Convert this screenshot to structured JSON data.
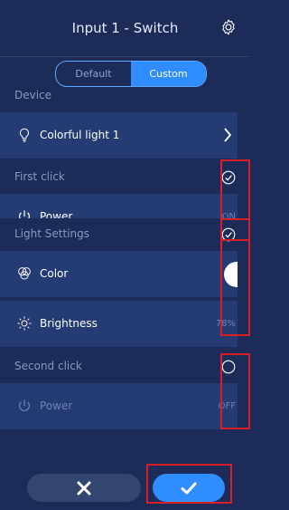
{
  "header": {
    "title": "Input 1 - Switch",
    "settings_icon": "gear-icon"
  },
  "mode_toggle": {
    "options": [
      "Default",
      "Custom"
    ],
    "selected": "Custom"
  },
  "device": {
    "section_label": "Device",
    "name": "Colorful light 1",
    "icon": "bulb-icon"
  },
  "first_click": {
    "section_label": "First click",
    "checked": true,
    "power": {
      "label": "Power",
      "value": "ON"
    }
  },
  "light_settings": {
    "section_label": "Light Settings",
    "checked": true,
    "color": {
      "label": "Color",
      "swatch": "#ffffff"
    },
    "brightness": {
      "label": "Brightness",
      "value": "78%"
    }
  },
  "second_click": {
    "section_label": "Second click",
    "checked": false,
    "power": {
      "label": "Power",
      "value": "OFF"
    }
  },
  "footer": {
    "cancel_icon": "close-icon",
    "confirm_icon": "check-icon"
  },
  "colors": {
    "background": "#1c2b58",
    "row": "#253b73",
    "accent": "#2f8dff",
    "highlight": "#d81f26"
  }
}
